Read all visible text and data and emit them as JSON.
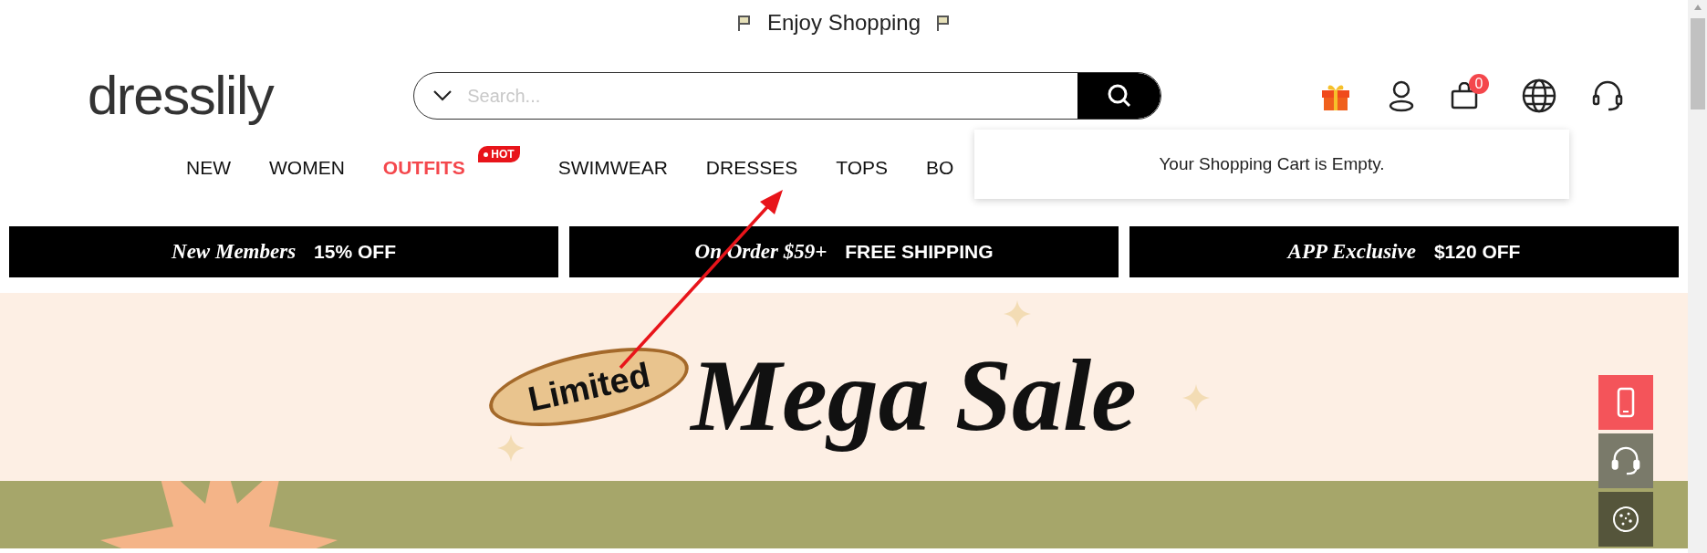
{
  "announcement": {
    "text": "Enjoy Shopping"
  },
  "logo": {
    "text": "dresslily"
  },
  "search": {
    "placeholder": "Search..."
  },
  "cart": {
    "count": "0",
    "popup": "Your Shopping Cart is Empty."
  },
  "nav": [
    {
      "label": "NEW",
      "hot": false
    },
    {
      "label": "WOMEN",
      "hot": false
    },
    {
      "label": "OUTFITS",
      "hot": true,
      "badge": "HOT"
    },
    {
      "label": "SWIMWEAR",
      "hot": false
    },
    {
      "label": "DRESSES",
      "hot": false
    },
    {
      "label": "TOPS",
      "hot": false
    },
    {
      "label": "BO",
      "hot": false
    }
  ],
  "promos": [
    {
      "script": "New Members",
      "bold": "15% OFF"
    },
    {
      "script": "On Order $59+",
      "bold": "FREE SHIPPING"
    },
    {
      "script": "APP Exclusive",
      "bold": "$120 OFF"
    }
  ],
  "banner": {
    "tag": "Limited",
    "title": "Mega Sale"
  }
}
